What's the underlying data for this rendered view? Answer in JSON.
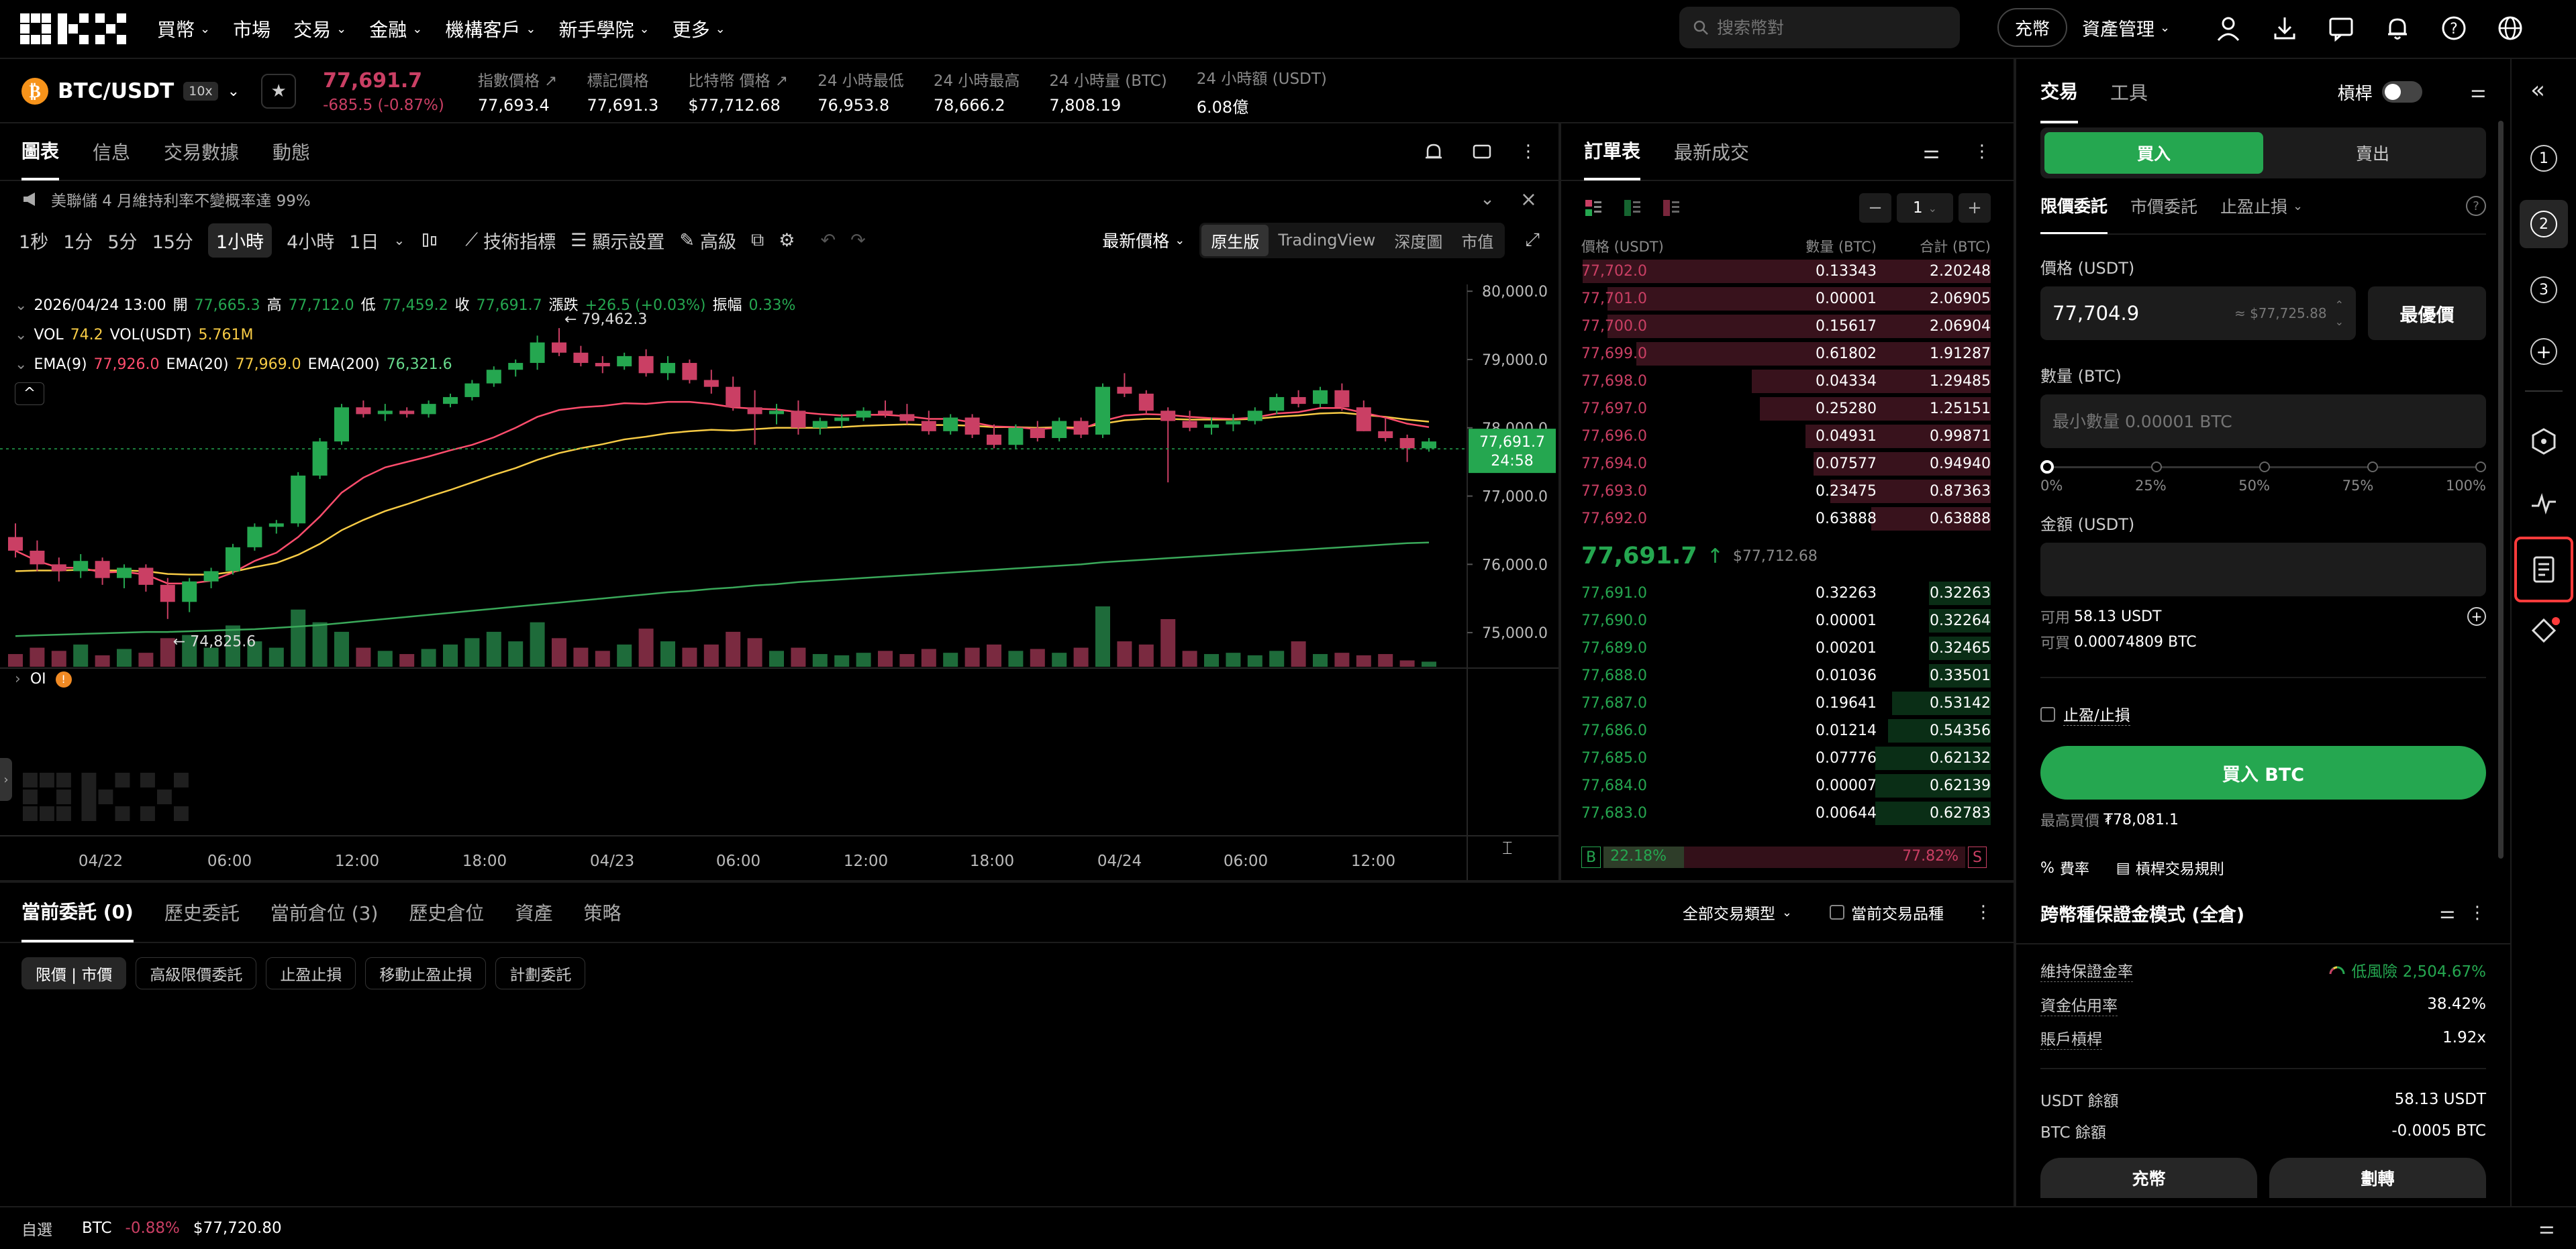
{
  "nav": {
    "menu": [
      "買幣",
      "市場",
      "交易",
      "金融",
      "機構客戶",
      "新手學院",
      "更多"
    ],
    "search_placeholder": "搜索幣對",
    "deposit": "充幣",
    "assets": "資產管理"
  },
  "ticker": {
    "pair": "BTC/USDT",
    "leverage": "10x",
    "price": "77,691.7",
    "change": "-685.5 (-0.87%)",
    "stats": [
      {
        "label": "指數價格",
        "value": "77,693.4"
      },
      {
        "label": "標記價格",
        "value": "77,691.3"
      },
      {
        "label": "比特幣 價格",
        "value": "$77,712.68"
      },
      {
        "label": "24 小時最低",
        "value": "76,953.8"
      },
      {
        "label": "24 小時最高",
        "value": "78,666.2"
      },
      {
        "label": "24 小時量 (BTC)",
        "value": "7,808.19"
      },
      {
        "label": "24 小時額 (USDT)",
        "value": "6.08億"
      }
    ]
  },
  "chart_panel": {
    "tabs": [
      "圖表",
      "信息",
      "交易數據",
      "動態"
    ],
    "notice": "美聯儲 4 月維持利率不變概率達 99%",
    "intervals": [
      "1秒",
      "1分",
      "5分",
      "15分",
      "1小時",
      "4小時",
      "1日"
    ],
    "tools": [
      "技術指標",
      "顯示設置",
      "高級"
    ],
    "price_type": "最新價格",
    "views": [
      "原生版",
      "TradingView",
      "深度圖",
      "市值"
    ],
    "ohlc": {
      "time": "2026/04/24 13:00",
      "open_label": "開",
      "open": "77,665.3",
      "high_label": "高",
      "high": "77,712.0",
      "low_label": "低",
      "low": "77,459.2",
      "close_label": "收",
      "close": "77,691.7",
      "chg_label": "漲跌",
      "chg": "+26.5 (+0.03%)",
      "amp_label": "振幅",
      "amp": "0.33%"
    },
    "vol": {
      "label": "VOL",
      "v1": "74.2",
      "v2_label": "VOL(USDT)",
      "v2": "5.761M"
    },
    "ema": {
      "e1_label": "EMA(9)",
      "e1": "77,926.0",
      "e2_label": "EMA(20)",
      "e2": "77,969.0",
      "e3_label": "EMA(200)",
      "e3": "76,321.6"
    },
    "oi_label": "OI",
    "annot_high": "← 79,462.3",
    "annot_low": "← 74,825.6",
    "current_price": "77,691.7",
    "countdown": "24:58",
    "price_axis": [
      "80,000.0",
      "79,000.0",
      "78,000.0",
      "77,000.0",
      "76,000.0",
      "75,000.0"
    ],
    "time_axis": [
      "04/22",
      "06:00",
      "12:00",
      "18:00",
      "04/23",
      "06:00",
      "12:00",
      "18:00",
      "04/24",
      "06:00",
      "12:00"
    ]
  },
  "chart_data": {
    "type": "candlestick",
    "ylim": [
      74500,
      80100
    ],
    "candles": [
      [
        76400,
        76600,
        76100,
        76200
      ],
      [
        76200,
        76350,
        75900,
        76000
      ],
      [
        76000,
        76100,
        75750,
        75900
      ],
      [
        75900,
        76150,
        75800,
        76050
      ],
      [
        76050,
        76100,
        75700,
        75800
      ],
      [
        75800,
        76000,
        75650,
        75950
      ],
      [
        75950,
        76000,
        75600,
        75700
      ],
      [
        75700,
        75800,
        75200,
        75450
      ],
      [
        75450,
        75800,
        75300,
        75750
      ],
      [
        75750,
        75950,
        75650,
        75900
      ],
      [
        75900,
        76300,
        75850,
        76250
      ],
      [
        76250,
        76600,
        76200,
        76550
      ],
      [
        76550,
        76650,
        76450,
        76600
      ],
      [
        76600,
        77350,
        76550,
        77300
      ],
      [
        77300,
        77850,
        77250,
        77800
      ],
      [
        77800,
        78350,
        77750,
        78300
      ],
      [
        78300,
        78400,
        78150,
        78200
      ],
      [
        78200,
        78350,
        78100,
        78250
      ],
      [
        78250,
        78300,
        78150,
        78200
      ],
      [
        78200,
        78400,
        78150,
        78350
      ],
      [
        78350,
        78500,
        78300,
        78450
      ],
      [
        78450,
        78700,
        78400,
        78650
      ],
      [
        78650,
        78900,
        78600,
        78850
      ],
      [
        78850,
        79000,
        78750,
        78950
      ],
      [
        78950,
        79350,
        78850,
        79250
      ],
      [
        79250,
        79460,
        79050,
        79100
      ],
      [
        79100,
        79200,
        78900,
        78950
      ],
      [
        78950,
        79050,
        78800,
        78900
      ],
      [
        78900,
        79100,
        78850,
        79050
      ],
      [
        79050,
        79150,
        78750,
        78800
      ],
      [
        78800,
        79050,
        78700,
        78950
      ],
      [
        78950,
        79000,
        78650,
        78700
      ],
      [
        78700,
        78850,
        78500,
        78600
      ],
      [
        78600,
        78750,
        78250,
        78300
      ],
      [
        78300,
        78550,
        77750,
        78200
      ],
      [
        78200,
        78350,
        78050,
        78250
      ],
      [
        78250,
        78400,
        77900,
        78000
      ],
      [
        78000,
        78150,
        77900,
        78100
      ],
      [
        78100,
        78200,
        78000,
        78150
      ],
      [
        78150,
        78300,
        78100,
        78250
      ],
      [
        78250,
        78400,
        78150,
        78200
      ],
      [
        78200,
        78350,
        78050,
        78100
      ],
      [
        78100,
        78250,
        77900,
        77950
      ],
      [
        77950,
        78200,
        77900,
        78150
      ],
      [
        78150,
        78200,
        77850,
        77900
      ],
      [
        77900,
        78050,
        77700,
        77750
      ],
      [
        77750,
        78050,
        77700,
        78000
      ],
      [
        78000,
        78100,
        77800,
        77850
      ],
      [
        77850,
        78150,
        77800,
        78100
      ],
      [
        78100,
        78150,
        77850,
        77900
      ],
      [
        77900,
        78650,
        77850,
        78600
      ],
      [
        78600,
        78800,
        78450,
        78500
      ],
      [
        78500,
        78550,
        78200,
        78250
      ],
      [
        78250,
        78300,
        77200,
        78100
      ],
      [
        78100,
        78250,
        77950,
        78000
      ],
      [
        78000,
        78150,
        77900,
        78050
      ],
      [
        78050,
        78200,
        77950,
        78100
      ],
      [
        78100,
        78300,
        78050,
        78250
      ],
      [
        78250,
        78500,
        78200,
        78450
      ],
      [
        78450,
        78550,
        78300,
        78350
      ],
      [
        78350,
        78600,
        78300,
        78550
      ],
      [
        78550,
        78650,
        78250,
        78300
      ],
      [
        78300,
        78400,
        77950,
        77950
      ],
      [
        77950,
        78150,
        77800,
        77850
      ],
      [
        77850,
        77900,
        77500,
        77700
      ],
      [
        77700,
        77850,
        77650,
        77800
      ]
    ],
    "volumes": [
      20,
      30,
      25,
      35,
      18,
      28,
      22,
      45,
      50,
      30,
      65,
      40,
      30,
      90,
      70,
      55,
      30,
      25,
      20,
      28,
      35,
      45,
      55,
      40,
      70,
      45,
      30,
      25,
      35,
      60,
      40,
      30,
      35,
      55,
      45,
      25,
      30,
      20,
      18,
      22,
      25,
      20,
      28,
      22,
      30,
      35,
      25,
      28,
      22,
      30,
      95,
      40,
      35,
      75,
      25,
      20,
      22,
      18,
      25,
      40,
      20,
      22,
      18,
      20,
      10,
      8
    ],
    "ema9": [
      76200,
      76050,
      75950,
      75950,
      75880,
      75890,
      75850,
      75720,
      75720,
      75760,
      75880,
      76050,
      76170,
      76400,
      76700,
      77050,
      77270,
      77420,
      77500,
      77580,
      77670,
      77750,
      77860,
      78000,
      78160,
      78260,
      78300,
      78320,
      78360,
      78350,
      78380,
      78380,
      78350,
      78300,
      78280,
      78270,
      78230,
      78200,
      78180,
      78190,
      78190,
      78170,
      78130,
      78130,
      78080,
      78020,
      78010,
      77980,
      78000,
      77980,
      78100,
      78180,
      78200,
      78190,
      78160,
      78140,
      78130,
      78150,
      78210,
      78230,
      78290,
      78290,
      78220,
      78150,
      78060,
      78010
    ],
    "ema20": [
      75900,
      75910,
      75910,
      75920,
      75910,
      75910,
      75900,
      75860,
      75850,
      75850,
      75890,
      75960,
      76020,
      76140,
      76300,
      76500,
      76650,
      76780,
      76880,
      76990,
      77090,
      77200,
      77310,
      77410,
      77530,
      77630,
      77700,
      77760,
      77830,
      77870,
      77920,
      77950,
      77970,
      77960,
      77980,
      78000,
      78000,
      78000,
      78010,
      78030,
      78040,
      78050,
      78040,
      78040,
      78030,
      78010,
      78010,
      78000,
      78010,
      78000,
      78060,
      78110,
      78130,
      78130,
      78120,
      78120,
      78120,
      78130,
      78160,
      78180,
      78210,
      78220,
      78190,
      78160,
      78120,
      78090
    ],
    "ema200": [
      74950,
      74960,
      74970,
      74980,
      74990,
      75000,
      75010,
      75010,
      75020,
      75030,
      75040,
      75050,
      75070,
      75090,
      75110,
      75140,
      75170,
      75200,
      75230,
      75260,
      75290,
      75320,
      75350,
      75380,
      75410,
      75440,
      75470,
      75500,
      75530,
      75560,
      75590,
      75610,
      75640,
      75660,
      75690,
      75710,
      75740,
      75760,
      75780,
      75800,
      75820,
      75840,
      75860,
      75880,
      75900,
      75920,
      75940,
      75960,
      75980,
      76000,
      76030,
      76050,
      76070,
      76090,
      76110,
      76130,
      76150,
      76170,
      76190,
      76210,
      76230,
      76250,
      76270,
      76290,
      76310,
      76320
    ]
  },
  "orderbook": {
    "tabs": [
      "訂單表",
      "最新成交"
    ],
    "step": "1",
    "headers": [
      "價格 (USDT)",
      "數量 (BTC)",
      "合計 (BTC)"
    ],
    "asks": [
      {
        "p": "77,702.0",
        "q": "0.13343",
        "t": "2.20248",
        "d": 0.99
      },
      {
        "p": "77,701.0",
        "q": "0.00001",
        "t": "2.06905",
        "d": 0.93
      },
      {
        "p": "77,700.0",
        "q": "0.15617",
        "t": "2.06904",
        "d": 0.93
      },
      {
        "p": "77,699.0",
        "q": "0.61802",
        "t": "1.91287",
        "d": 0.86
      },
      {
        "p": "77,698.0",
        "q": "0.04334",
        "t": "1.29485",
        "d": 0.58
      },
      {
        "p": "77,697.0",
        "q": "0.25280",
        "t": "1.25151",
        "d": 0.56
      },
      {
        "p": "77,696.0",
        "q": "0.04931",
        "t": "0.99871",
        "d": 0.45
      },
      {
        "p": "77,694.0",
        "q": "0.07577",
        "t": "0.94940",
        "d": 0.43
      },
      {
        "p": "77,693.0",
        "q": "0.23475",
        "t": "0.87363",
        "d": 0.39
      },
      {
        "p": "77,692.0",
        "q": "0.63888",
        "t": "0.63888",
        "d": 0.29
      }
    ],
    "mid_price": "77,691.7",
    "mid_usd": "$77,712.68",
    "bids": [
      {
        "p": "77,691.0",
        "q": "0.32263",
        "t": "0.32263",
        "d": 0.15
      },
      {
        "p": "77,690.0",
        "q": "0.00001",
        "t": "0.32264",
        "d": 0.15
      },
      {
        "p": "77,689.0",
        "q": "0.00201",
        "t": "0.32465",
        "d": 0.15
      },
      {
        "p": "77,688.0",
        "q": "0.01036",
        "t": "0.33501",
        "d": 0.15
      },
      {
        "p": "77,687.0",
        "q": "0.19641",
        "t": "0.53142",
        "d": 0.24
      },
      {
        "p": "77,686.0",
        "q": "0.01214",
        "t": "0.54356",
        "d": 0.25
      },
      {
        "p": "77,685.0",
        "q": "0.07776",
        "t": "0.62132",
        "d": 0.28
      },
      {
        "p": "77,684.0",
        "q": "0.00007",
        "t": "0.62139",
        "d": 0.28
      },
      {
        "p": "77,683.0",
        "q": "0.00644",
        "t": "0.62783",
        "d": 0.28
      }
    ],
    "ratio": {
      "buy_label": "B",
      "buy": "22.18%",
      "sell_label": "S",
      "sell": "77.82%",
      "buy_pct": 22.18
    }
  },
  "trade": {
    "tabs": [
      "交易",
      "工具"
    ],
    "margin_label": "槓桿",
    "buy": "買入",
    "sell": "賣出",
    "order_types": [
      "限價委託",
      "市價委託",
      "止盈止損"
    ],
    "price_label": "價格 (USDT)",
    "price_value": "77,704.9",
    "price_hint": "≈ $77,725.88",
    "best_price": "最優價",
    "qty_label": "數量 (BTC)",
    "qty_placeholder": "最小數量 0.00001 BTC",
    "slider": [
      "0%",
      "25%",
      "50%",
      "75%",
      "100%"
    ],
    "amount_label": "金額 (USDT)",
    "available_label": "可用",
    "available": "58.13 USDT",
    "can_buy_label": "可買",
    "can_buy": "0.00074809 BTC",
    "tpsl": "止盈/止損",
    "submit": "買入 BTC",
    "max_buy_label": "最高買價",
    "max_buy": "₮78,081.1",
    "fee": "費率",
    "rules": "槓桿交易規則"
  },
  "orders": {
    "tabs": [
      "當前委託 (0)",
      "歷史委託",
      "當前倉位 (3)",
      "歷史倉位",
      "資產",
      "策略"
    ],
    "filter": "全部交易類型",
    "current_only": "當前交易品種",
    "chips": [
      "限價 | 市價",
      "高級限價委託",
      "止盈止損",
      "移動止盈止損",
      "計劃委託"
    ]
  },
  "account": {
    "title": "跨幣種保證金模式 (全倉)",
    "rows": [
      {
        "k": "維持保證金率",
        "v": "低風險 2,504.67%"
      },
      {
        "k": "資金佔用率",
        "v": "38.42%"
      },
      {
        "k": "賬戶槓桿",
        "v": "1.92x"
      }
    ],
    "balances": [
      {
        "k": "USDT 餘額",
        "v": "58.13 USDT"
      },
      {
        "k": "BTC 餘額",
        "v": "-0.0005 BTC"
      }
    ],
    "deposit": "充幣",
    "transfer": "劃轉"
  },
  "footer": {
    "watch": "自選",
    "coin": "BTC",
    "chg": "-0.88%",
    "price": "$77,720.80"
  },
  "rail": [
    "1",
    "2",
    "3"
  ],
  "colors": {
    "green": "#25a750",
    "red": "#ca3f64",
    "accent": "#ff3b3b",
    "yellow": "#f7cb45"
  }
}
